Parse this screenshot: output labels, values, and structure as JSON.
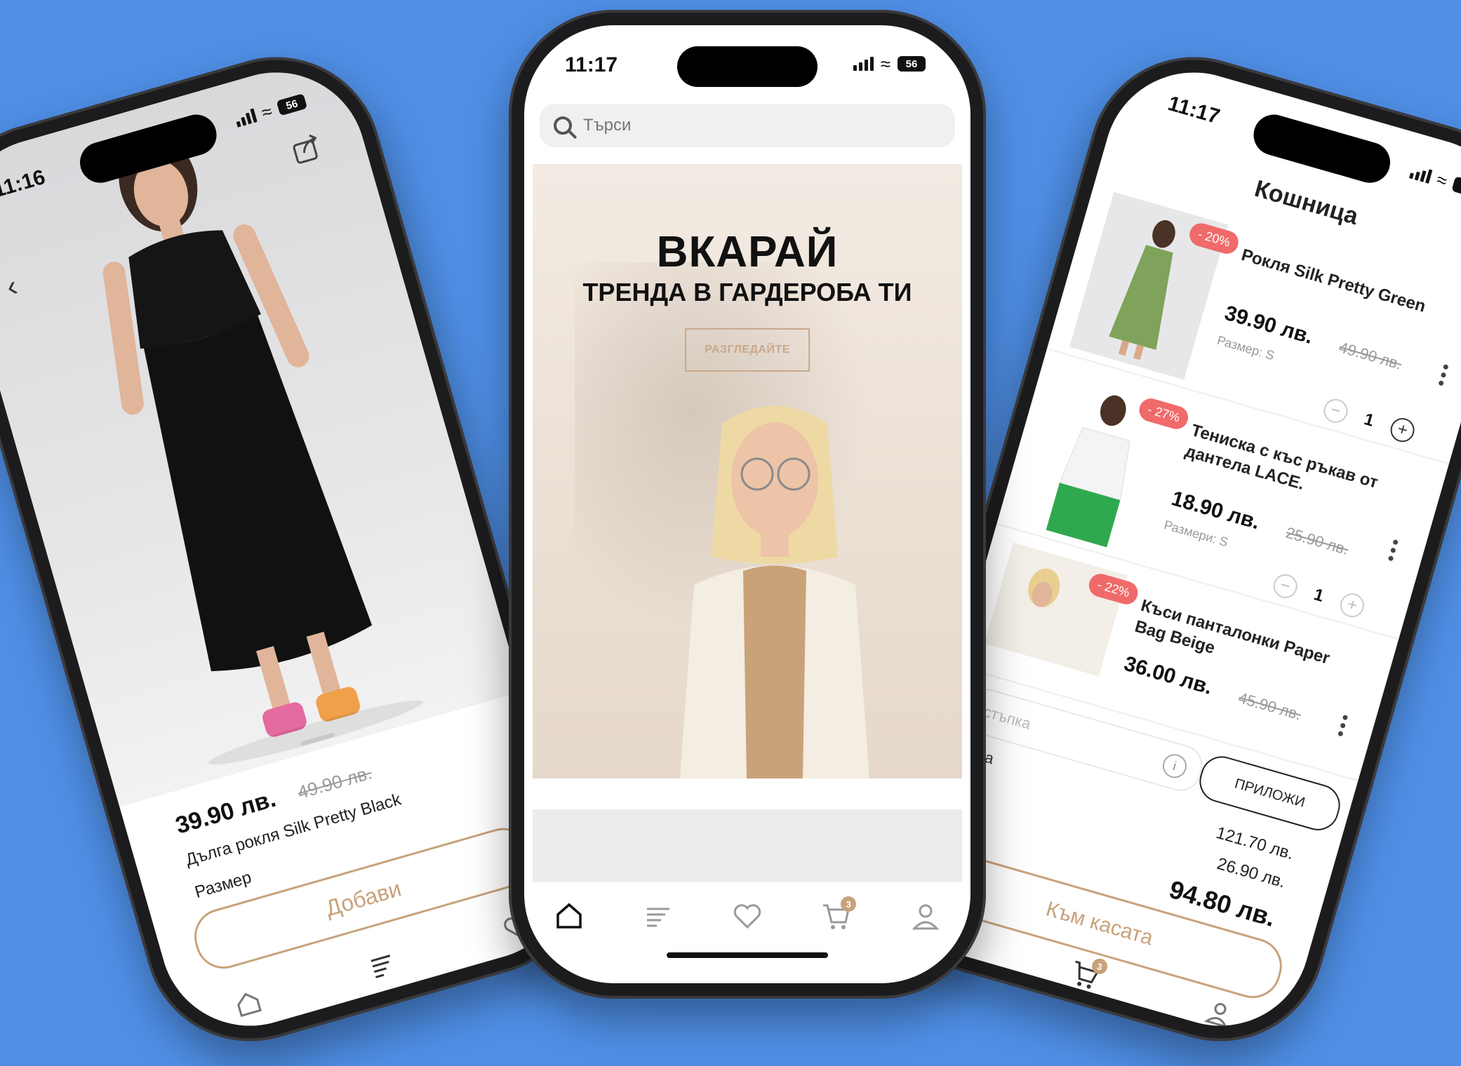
{
  "colors": {
    "background": "#4f8fe6",
    "accent_gold": "#c8a27a",
    "discount_red": "#f06a6a",
    "cart_badge": "#c8a27a"
  },
  "product_screen": {
    "time": "11:16",
    "battery": "56",
    "price": "39.90 лв.",
    "old_price": "49.90 лв.",
    "name": "Дълга рокля Silk Pretty Black",
    "size_label": "Размер",
    "add_button": "Добави",
    "icons": [
      "back-icon",
      "share-icon",
      "home-icon",
      "catalog-icon",
      "heart-icon"
    ]
  },
  "home_screen": {
    "time": "11:17",
    "battery": "56",
    "search_placeholder": "Търси",
    "hero_title": "ВКАРАЙ",
    "hero_subtitle": "ТРЕНДА В ГАРДЕРОБА ТИ",
    "hero_cta": "РАЗГЛЕДАЙТЕ",
    "cart_count": "3",
    "tabs": [
      "home-icon",
      "catalog-icon",
      "heart-icon",
      "cart-icon",
      "user-icon"
    ]
  },
  "cart_screen": {
    "time": "11:17",
    "battery": "56",
    "title": "Кошница",
    "items": [
      {
        "name": "Рокля Silk Pretty Green",
        "price": "39.90 лв.",
        "old_price": "49.90 лв.",
        "discount": "- 20%",
        "size": "Размер: S",
        "qty": "1"
      },
      {
        "name": "Тениска с къс ръкав от дантела LACE.",
        "price": "18.90 лв.",
        "old_price": "25.90 лв.",
        "discount": "- 27%",
        "size": "Размери: S",
        "qty": "1"
      },
      {
        "name": "Къси панталонки Paper Bag Beige",
        "price": "36.00 лв.",
        "old_price": "45.90 лв.",
        "discount": "- 22%",
        "size": "",
        "qty": ""
      }
    ],
    "promo_placeholder": "стъпка",
    "apply_button": "ПРИЛОЖИ",
    "sum_label": "ума",
    "subtotal": "121.70 лв.",
    "discount_total": "26.90 лв.",
    "total": "94.80 лв.",
    "checkout_button": "Към касата",
    "cart_count": "3"
  }
}
